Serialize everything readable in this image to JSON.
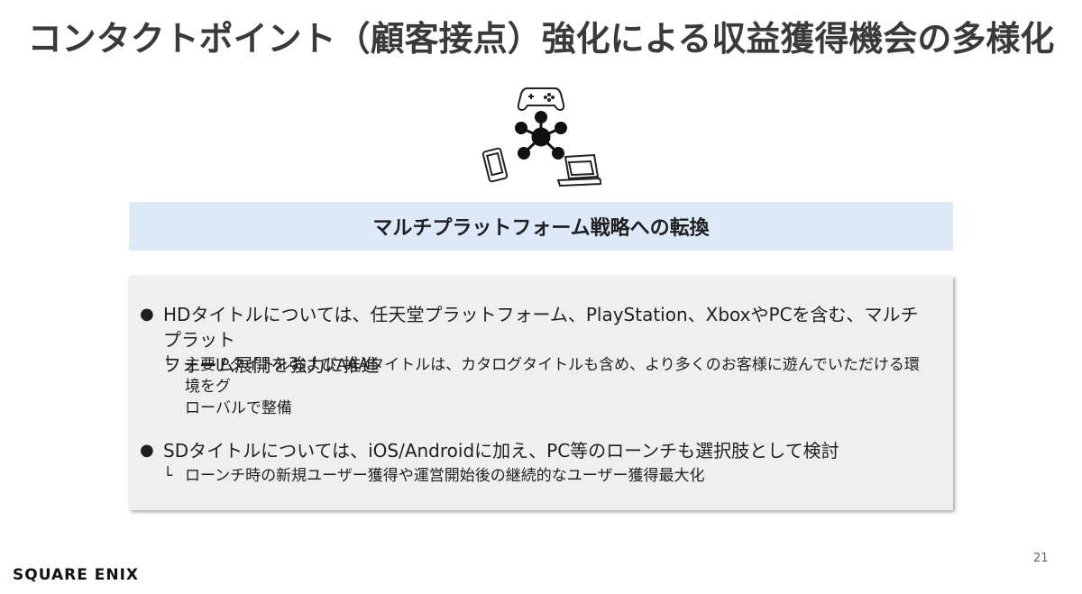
{
  "slide": {
    "title": "コンタクトポイント（顧客接点）強化による収益獲得機会の多様化",
    "banner": "マルチプラットフォーム戦略への転換",
    "icons": [
      "gamepad-icon",
      "smartphone-icon",
      "laptop-icon",
      "network-hub-icon"
    ],
    "bullets": [
      {
        "marker": "●",
        "line1": "HDタイトルについては、任天堂プラットフォーム、PlayStation、XboxやPCを含む、マルチプラット",
        "line2": "フォーム展開を強力に推進",
        "sub_marker": "└",
        "sub_line1": "主要IPタイトルおよびAAAタイトルは、カタログタイトルも含め、より多くのお客様に遊んでいただける環境をグ",
        "sub_line2": "ローバルで整備"
      },
      {
        "marker": "●",
        "line1": "SDタイトルについては、iOS/Androidに加え、PC等のローンチも選択肢として検討",
        "sub_marker": "└",
        "sub_line1": "ローンチ時の新規ユーザー獲得や運営開始後の継続的なユーザー獲得最大化"
      }
    ],
    "logo": "SQUARE ENIX",
    "page_number": "21"
  }
}
